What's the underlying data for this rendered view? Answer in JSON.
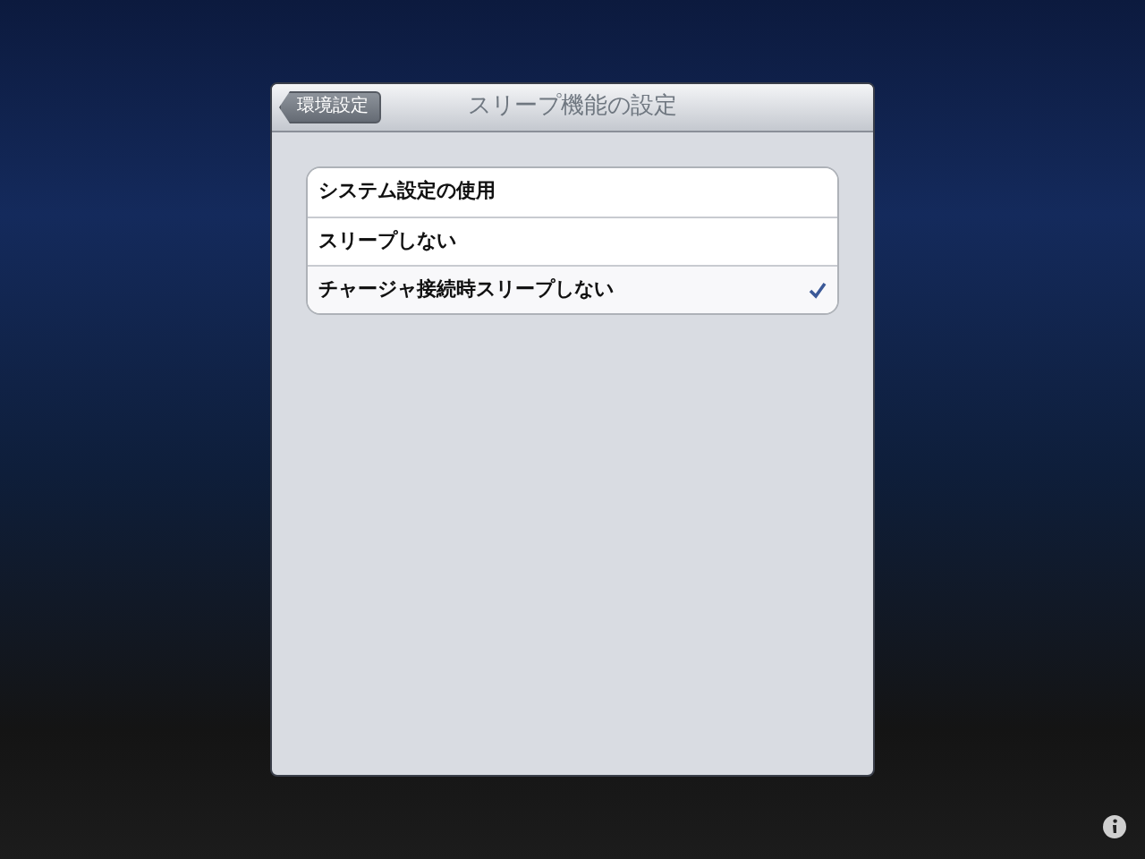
{
  "nav_bar": {
    "back_button": "環境設定",
    "title": "スリープ機能の設定"
  },
  "options": [
    {
      "label": "システム設定の使用",
      "selected": false
    },
    {
      "label": "スリープしない",
      "selected": false
    },
    {
      "label": "チャージャ接続時スリープしない",
      "selected": true
    }
  ]
}
